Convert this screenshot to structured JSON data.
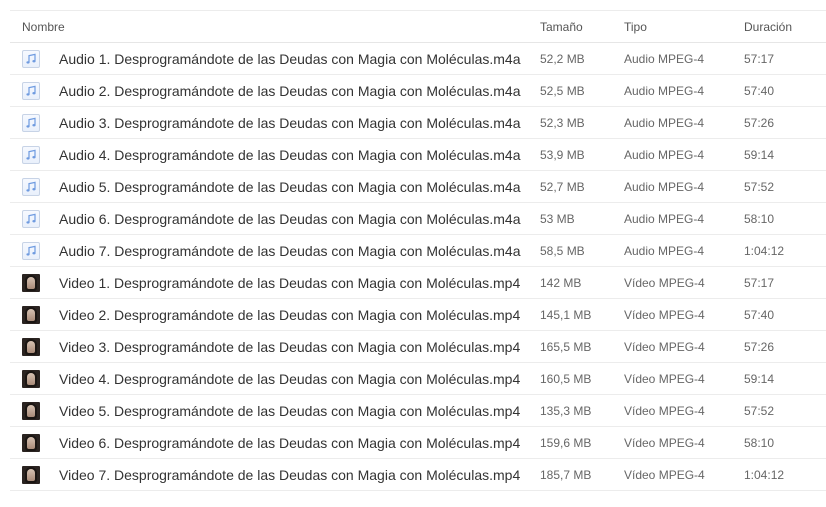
{
  "columns": {
    "name": "Nombre",
    "size": "Tamaño",
    "type": "Tipo",
    "duration": "Duración"
  },
  "files": [
    {
      "icon": "audio-file-icon",
      "name": "Audio 1. Desprogramándote de las Deudas con Magia con Moléculas.m4a",
      "size": "52,2 MB",
      "type": "Audio MPEG-4",
      "duration": "57:17"
    },
    {
      "icon": "audio-file-icon",
      "name": "Audio 2. Desprogramándote de las Deudas con Magia con Moléculas.m4a",
      "size": "52,5 MB",
      "type": "Audio MPEG-4",
      "duration": "57:40"
    },
    {
      "icon": "audio-file-icon",
      "name": "Audio 3. Desprogramándote de las Deudas con Magia con Moléculas.m4a",
      "size": "52,3 MB",
      "type": "Audio MPEG-4",
      "duration": "57:26"
    },
    {
      "icon": "audio-file-icon",
      "name": "Audio 4. Desprogramándote de las Deudas con Magia con Moléculas.m4a",
      "size": "53,9 MB",
      "type": "Audio MPEG-4",
      "duration": "59:14"
    },
    {
      "icon": "audio-file-icon",
      "name": "Audio 5. Desprogramándote de las Deudas con Magia con Moléculas.m4a",
      "size": "52,7 MB",
      "type": "Audio MPEG-4",
      "duration": "57:52"
    },
    {
      "icon": "audio-file-icon",
      "name": "Audio 6. Desprogramándote de las Deudas con Magia con Moléculas.m4a",
      "size": "53 MB",
      "type": "Audio MPEG-4",
      "duration": "58:10"
    },
    {
      "icon": "audio-file-icon",
      "name": "Audio 7. Desprogramándote de las Deudas con Magia con Moléculas.m4a",
      "size": "58,5 MB",
      "type": "Audio MPEG-4",
      "duration": "1:04:12"
    },
    {
      "icon": "video-thumbnail-icon",
      "name": "Video 1. Desprogramándote de las Deudas con Magia con Moléculas.mp4",
      "size": "142 MB",
      "type": "Vídeo MPEG-4",
      "duration": "57:17"
    },
    {
      "icon": "video-thumbnail-icon",
      "name": "Video 2. Desprogramándote de las Deudas con Magia con Moléculas.mp4",
      "size": "145,1 MB",
      "type": "Vídeo MPEG-4",
      "duration": "57:40"
    },
    {
      "icon": "video-thumbnail-icon",
      "name": "Video 3. Desprogramándote de las Deudas con Magia con Moléculas.mp4",
      "size": "165,5 MB",
      "type": "Vídeo MPEG-4",
      "duration": "57:26"
    },
    {
      "icon": "video-thumbnail-icon",
      "name": "Video 4. Desprogramándote de las Deudas con Magia con Moléculas.mp4",
      "size": "160,5 MB",
      "type": "Vídeo MPEG-4",
      "duration": "59:14"
    },
    {
      "icon": "video-thumbnail-icon",
      "name": "Video 5. Desprogramándote de las Deudas con Magia con Moléculas.mp4",
      "size": "135,3 MB",
      "type": "Vídeo MPEG-4",
      "duration": "57:52"
    },
    {
      "icon": "video-thumbnail-icon",
      "name": "Video 6. Desprogramándote de las Deudas con Magia con Moléculas.mp4",
      "size": "159,6 MB",
      "type": "Vídeo MPEG-4",
      "duration": "58:10"
    },
    {
      "icon": "video-thumbnail-icon",
      "name": "Video 7. Desprogramándote de las Deudas con Magia con Moléculas.mp4",
      "size": "185,7 MB",
      "type": "Vídeo MPEG-4",
      "duration": "1:04:12"
    }
  ],
  "colors": {
    "text": "#333333",
    "meta_text": "#666666",
    "divider": "#ececec",
    "audio_icon_note": "#6f9be0",
    "video_icon_bg": "#2a2320"
  }
}
